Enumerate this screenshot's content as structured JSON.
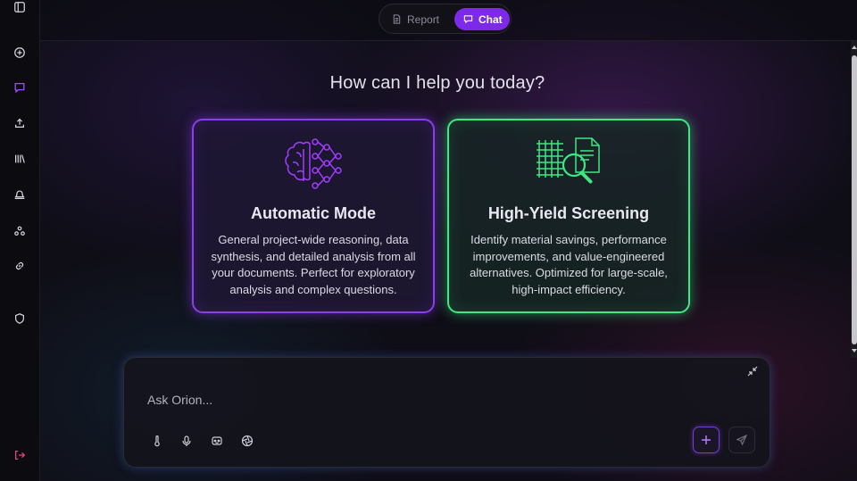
{
  "sidebar": {
    "items": [
      {
        "name": "toggle-sidebar-icon"
      },
      {
        "name": "new-chat-icon"
      },
      {
        "name": "chat-icon"
      },
      {
        "name": "upload-icon"
      },
      {
        "name": "library-icon"
      },
      {
        "name": "bell-icon"
      },
      {
        "name": "network-icon"
      },
      {
        "name": "link-icon"
      },
      {
        "name": "shield-icon"
      },
      {
        "name": "logout-icon"
      }
    ]
  },
  "header": {
    "toggle": {
      "report_label": "Report",
      "chat_label": "Chat",
      "active": "Chat"
    }
  },
  "main": {
    "heading": "How can I help you today?",
    "cards": [
      {
        "title": "Automatic Mode",
        "description": "General project-wide reasoning, data synthesis, and detailed analysis from all your documents. Perfect for exploratory analysis and complex questions.",
        "icon": "brain-network-icon"
      },
      {
        "title": "High-Yield Screening",
        "description": "Identify material savings, performance improvements, and value-engineered alternatives. Optimized for large-scale, high-impact efficiency.",
        "icon": "grid-magnifier-icon"
      }
    ]
  },
  "chat": {
    "placeholder": "Ask Orion...",
    "value": "",
    "tools": [
      "thermometer-icon",
      "microphone-icon",
      "robot-icon",
      "aperture-icon"
    ]
  },
  "colors": {
    "accent_purple": "#7c2ae8",
    "accent_green": "#3ee883",
    "logout_red": "#e0457a"
  }
}
